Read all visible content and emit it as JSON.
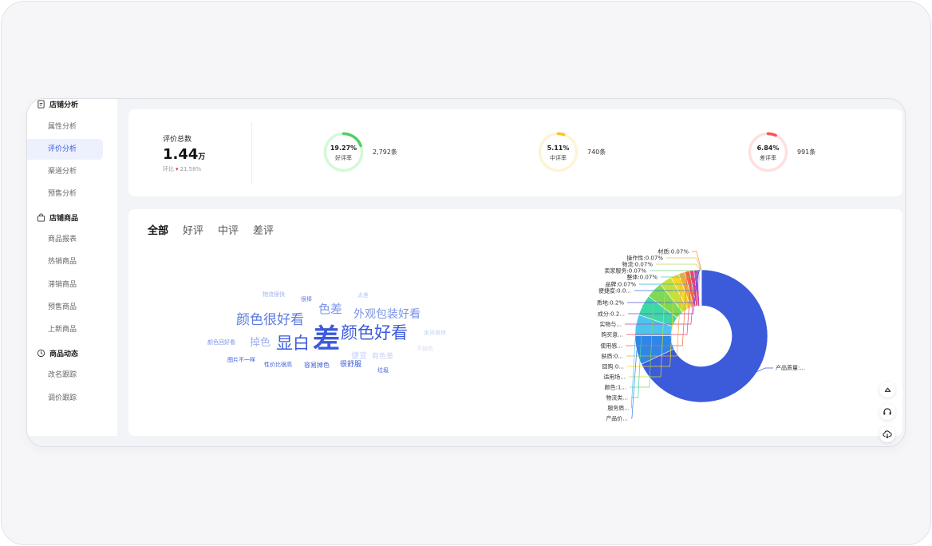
{
  "sidebar": {
    "groups": [
      {
        "label": "店铺分析",
        "items": [
          "属性分析",
          "评价分析",
          "渠道分析",
          "预售分析"
        ]
      },
      {
        "label": "店铺商品",
        "items": [
          "商品报表",
          "热销商品",
          "滞销商品",
          "预售商品",
          "上新商品"
        ]
      },
      {
        "label": "商品动态",
        "items": [
          "改名跟踪",
          "调价跟踪"
        ]
      }
    ],
    "active_item": "评价分析"
  },
  "stats": {
    "total_label": "评价总数",
    "total_value": "1.44",
    "total_unit": "万",
    "change_label": "环比",
    "change_value": "21.58%",
    "rings": [
      {
        "pct": "19.27%",
        "label": "好评率",
        "count": "2,792条",
        "color": "#51cf66",
        "track": "#d3f9d8",
        "value": 19.27
      },
      {
        "pct": "5.11%",
        "label": "中评率",
        "count": "740条",
        "color": "#fcc419",
        "track": "#fff3d6",
        "value": 5.11
      },
      {
        "pct": "6.84%",
        "label": "差评率",
        "count": "991条",
        "color": "#fa5252",
        "track": "#ffe0e0",
        "value": 6.84
      }
    ]
  },
  "tabs": [
    "全部",
    "好评",
    "中评",
    "差评"
  ],
  "active_tab": "全部",
  "word_cloud": [
    "差",
    "颜色好看",
    "显白",
    "颜色很好看",
    "外观包装好看",
    "色差",
    "掉色",
    "很棒",
    "物流很快",
    "太差",
    "发货很快",
    "颜色回好看",
    "便宜",
    "有色差",
    "不掉色",
    "图片不一样",
    "性价比很高",
    "容易掉色",
    "很舒服",
    "垃圾"
  ],
  "pie_labels_top": [
    "材质:0.07%",
    "操作性:0.07%",
    "物流:0.07%",
    "卖家服务:0.07%",
    "整体:0.07%",
    "品牌:0.07%",
    "便捷度:0.0...",
    "质地:0.2%",
    "成分:0.2...",
    "实物与...",
    "购买意...",
    "使用感...",
    "肤质:0...",
    "回购:0...",
    "适用场...",
    "颜色:1...",
    "物流类...",
    "服务质...",
    "产品价..."
  ],
  "pie_label_main": "产品质量:...",
  "chart_data": {
    "type": "pie",
    "donut": true,
    "categories": [
      "产品质量",
      "产品价格",
      "服务质量",
      "物流类",
      "颜色",
      "适用场景",
      "回购",
      "肤质",
      "使用感",
      "购买意向",
      "实物与描述",
      "成分",
      "质地",
      "便捷度",
      "品牌",
      "整体",
      "卖家服务",
      "物流",
      "操作性",
      "材质"
    ],
    "values": [
      67,
      7,
      5,
      5,
      4,
      3,
      2,
      1.5,
      1.2,
      1,
      0.9,
      0.2,
      0.2,
      0.07,
      0.07,
      0.07,
      0.07,
      0.07,
      0.07,
      0.07
    ],
    "colors": [
      "#3b5bdb",
      "#2f86e6",
      "#4cc4f0",
      "#3fd6a8",
      "#7ed957",
      "#c5e03a",
      "#f5d623",
      "#f2a93b",
      "#f06a3b",
      "#e8436d",
      "#c93fb5",
      "#8f49d4",
      "#5a5be0",
      "#3a7ce8",
      "#38b0e8",
      "#40d0c8",
      "#6fd48a",
      "#b8d85a",
      "#f0c04a",
      "#f08c4a"
    ]
  }
}
